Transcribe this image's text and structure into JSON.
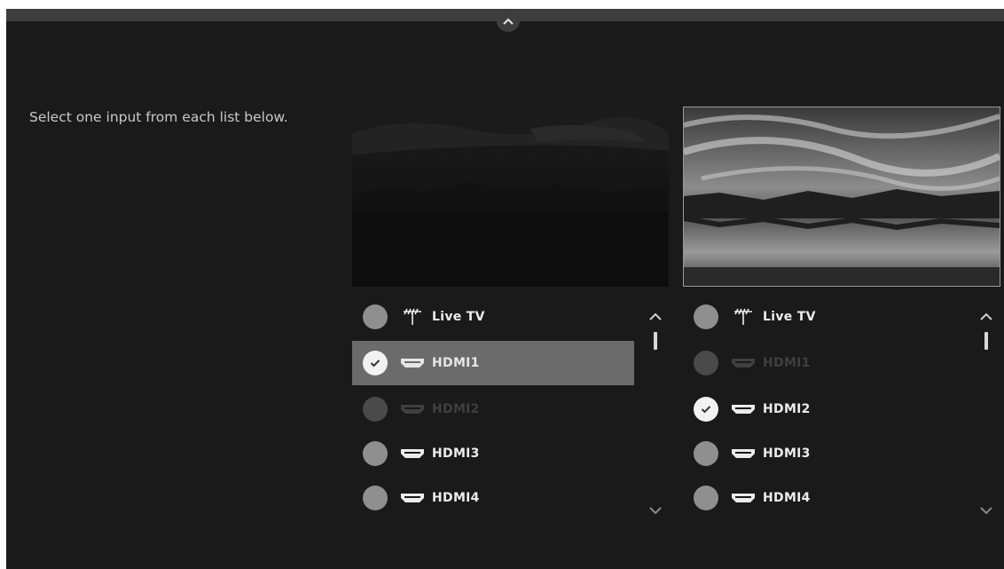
{
  "instruction": "Select one input from each list below.",
  "colors": {
    "screen_bg": "#1a1a1a",
    "selected_row": "#6b6b6b",
    "radio_idle": "#8f8f8f",
    "radio_disabled": "#4a4a4a",
    "radio_checked": "#f2f2f2"
  },
  "lists": {
    "left": {
      "items": [
        {
          "label": "Live TV",
          "icon": "antenna-icon",
          "state": "idle"
        },
        {
          "label": "HDMI1",
          "icon": "hdmi-icon",
          "state": "selected"
        },
        {
          "label": "HDMI2",
          "icon": "hdmi-icon",
          "state": "disabled"
        },
        {
          "label": "HDMI3",
          "icon": "hdmi-icon",
          "state": "idle"
        },
        {
          "label": "HDMI4",
          "icon": "hdmi-icon",
          "state": "idle"
        }
      ]
    },
    "right": {
      "items": [
        {
          "label": "Live TV",
          "icon": "antenna-icon",
          "state": "idle"
        },
        {
          "label": "HDMI1",
          "icon": "hdmi-icon",
          "state": "disabled"
        },
        {
          "label": "HDMI2",
          "icon": "hdmi-icon",
          "state": "checked"
        },
        {
          "label": "HDMI3",
          "icon": "hdmi-icon",
          "state": "idle"
        },
        {
          "label": "HDMI4",
          "icon": "hdmi-icon",
          "state": "idle"
        }
      ]
    }
  }
}
